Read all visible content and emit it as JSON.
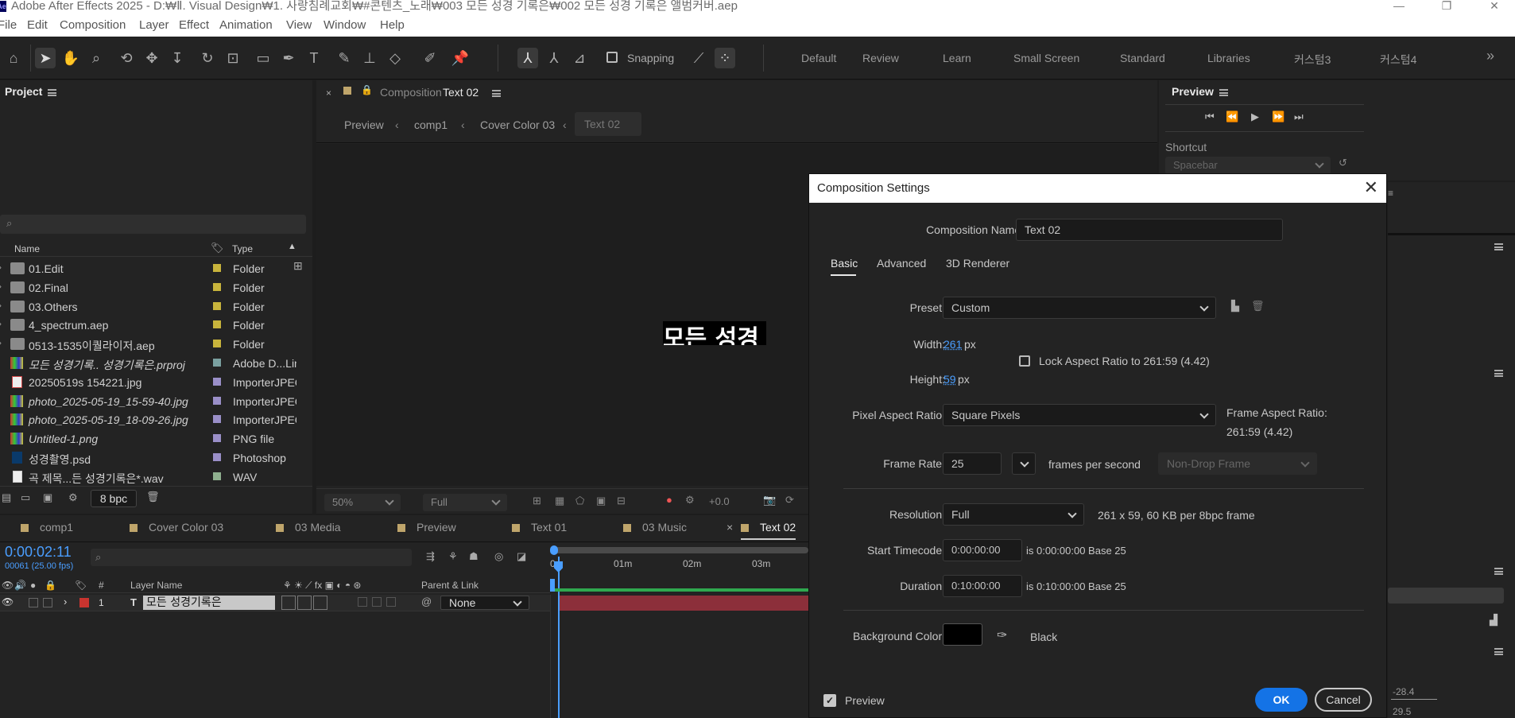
{
  "window": {
    "title": "Adobe After Effects 2025 - D:₩Ⅱ. Visual Design₩1. 사랑침례교회₩#콘텐츠_노래₩003 모든 성경 기록은₩002 모든 성경 기록은 앨범커버.aep",
    "minimize": "—",
    "restore": "❐",
    "close": "✕"
  },
  "menu": [
    "File",
    "Edit",
    "Composition",
    "Layer",
    "Effect",
    "Animation",
    "View",
    "Window",
    "Help"
  ],
  "toolbar": {
    "snapping_label": "Snapping",
    "workspaces": [
      "Default",
      "Review",
      "Learn",
      "Small Screen",
      "Standard",
      "Libraries",
      "커스텀3",
      "커스텀4"
    ],
    "more": "»"
  },
  "project": {
    "title": "Project",
    "col_name": "Name",
    "col_type": "Type",
    "items": [
      {
        "name": "01.Edit",
        "type": "Folder",
        "kind": "folder",
        "label": "#c8b43c"
      },
      {
        "name": "02.Final",
        "type": "Folder",
        "kind": "folder",
        "label": "#c8b43c"
      },
      {
        "name": "03.Others",
        "type": "Folder",
        "kind": "folder",
        "label": "#c8b43c"
      },
      {
        "name": "4_spectrum.aep",
        "type": "Folder",
        "kind": "folder",
        "label": "#c8b43c"
      },
      {
        "name": "0513-1535이퀄라이저.aep",
        "type": "Folder",
        "kind": "folder",
        "label": "#c8b43c"
      },
      {
        "name": "모든 성경기록.. 성경기록은.prproj",
        "type": "Adobe D...Lin",
        "kind": "footage",
        "label": "#7aa0a0"
      },
      {
        "name": "20250519s 154221.jpg",
        "type": "ImporterJPEG",
        "kind": "image",
        "label": "#9a8fc8"
      },
      {
        "name": "photo_2025-05-19_15-59-40.jpg",
        "type": "ImporterJPEG",
        "kind": "footage",
        "label": "#9a8fc8"
      },
      {
        "name": "photo_2025-05-19_18-09-26.jpg",
        "type": "ImporterJPEG",
        "kind": "footage",
        "label": "#9a8fc8"
      },
      {
        "name": "Untitled-1.png",
        "type": "PNG file",
        "kind": "footage",
        "label": "#9a8fc8"
      },
      {
        "name": "성경촬영.psd",
        "type": "Photoshop",
        "kind": "psd",
        "label": "#9a8fc8"
      },
      {
        "name": "곡 제목...든 성경기록은*.wav",
        "type": "WAV",
        "kind": "audio",
        "label": "#8fb08f"
      }
    ],
    "bpc": "8 bpc"
  },
  "composition_viewer": {
    "tab_prefix": "Composition",
    "tab_name": "Text 02",
    "breadcrumbs": [
      "Preview",
      "comp1",
      "Cover Color 03",
      "Text 02"
    ],
    "canvas_text": "모든 성경",
    "zoom": "50%",
    "resolution": "Full",
    "exposure": "+0.0"
  },
  "preview_panel": {
    "title": "Preview",
    "shortcut_label": "Shortcut",
    "shortcut_value": "Spacebar"
  },
  "right_values": [
    "-28.4",
    "29.5"
  ],
  "timeline": {
    "tabs": [
      "comp1",
      "Cover Color 03",
      "03 Media",
      "Preview",
      "Text 01",
      "03 Music",
      "Text 02"
    ],
    "timecode": "0:00:02:11",
    "frame_info": "00061 (25.00 fps)",
    "ruler": [
      "0m",
      "01m",
      "02m",
      "03m"
    ],
    "col_layer_name": "Layer Name",
    "col_parent": "Parent & Link",
    "col_num": "#",
    "layer": {
      "index": "1",
      "name": "모든 성경기록은",
      "parent": "None"
    }
  },
  "dialog": {
    "title": "Composition Settings",
    "name_label": "Composition Name:",
    "name_value": "Text 02",
    "tabs": [
      "Basic",
      "Advanced",
      "3D Renderer"
    ],
    "preset_label": "Preset:",
    "preset_value": "Custom",
    "width_label": "Width:",
    "width_value": "261",
    "height_label": "Height:",
    "height_value": "59",
    "px": "px",
    "lock_label": "Lock Aspect Ratio to 261:59 (4.42)",
    "par_label": "Pixel Aspect Ratio:",
    "par_value": "Square Pixels",
    "far_label": "Frame Aspect Ratio:",
    "far_value": "261:59 (4.42)",
    "fps_label": "Frame Rate:",
    "fps_value": "25",
    "fps_unit": "frames per second",
    "drop_frame": "Non-Drop Frame",
    "res_label": "Resolution:",
    "res_value": "Full",
    "res_info": "261 x 59, 60 KB per 8bpc frame",
    "start_label": "Start Timecode:",
    "start_value": "0:00:00:00",
    "start_info": "is 0:00:00:00  Base 25",
    "dur_label": "Duration:",
    "dur_value": "0:10:00:00",
    "dur_info": "is 0:10:00:00  Base 25",
    "bg_label": "Background Color:",
    "bg_color": "#000000",
    "bg_name": "Black",
    "preview_label": "Preview",
    "ok": "OK",
    "cancel": "Cancel"
  }
}
